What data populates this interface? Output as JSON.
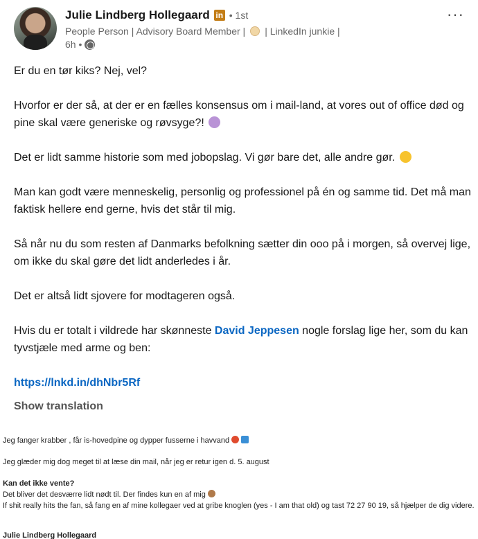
{
  "author": {
    "name": "Julie Lindberg Hollegaard",
    "badge": "in",
    "degree": "• 1st",
    "headline_part1": "People Person | Advisory Board Member |",
    "headline_part2": "| LinkedIn junkie |",
    "time": "6h •"
  },
  "menu": {
    "more_label": "···"
  },
  "post": {
    "p1": "Er du en tør kiks? Nej, vel?",
    "p2": "Hvorfor er der så, at der er en fælles konsensus om i mail-land, at vores out of office død og pine skal være generiske og røvsyge?!",
    "p3": "Det er lidt samme historie som med jobopslag. Vi gør bare det, alle andre gør.",
    "p4": "Man kan godt være menneskelig, personlig og professionel på én og samme tid. Det må man faktisk hellere end gerne, hvis det står til mig.",
    "p5": "Så når nu du som resten af Danmarks befolkning sætter din ooo på i morgen, så overvej lige, om ikke du skal gøre det lidt anderledes i år.",
    "p6": "Det er altså lidt sjovere for modtageren også.",
    "p7_before": "Hvis du er totalt i vildrede har skønneste ",
    "p7_mention": "David Jeppesen",
    "p7_after": " nogle forslag lige her, som du kan tyvstjæle med arme og ben:",
    "link": "https://lnkd.in/dhNbr5Rf",
    "show_translation": "Show translation"
  },
  "image_text": {
    "line1": "Jeg fanger krabber , får is-hovedpine og dypper fusserne i havvand",
    "line2": "Jeg glæder mig dog meget til at læse din mail, når jeg er retur igen d. 5. august",
    "line3": "Kan det ikke vente?",
    "line4": "Det bliver det desværre lidt nødt til. Der findes kun en af mig",
    "line5": "If shit really hits the fan, så fang en af mine kollegaer ved at gribe knoglen (yes - I am that old) og tast 72 27 90 19, så hjælper de dig videre.",
    "line6": "Julie Lindberg Hollegaard"
  }
}
